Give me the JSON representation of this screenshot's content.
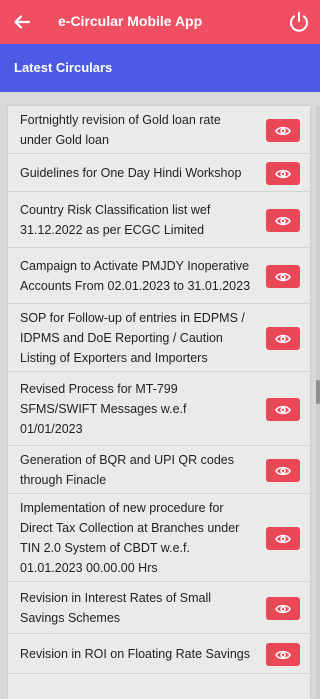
{
  "app": {
    "title": "e-Circular Mobile App"
  },
  "section": {
    "title": "Latest Circulars"
  },
  "colors": {
    "topbar": "#ef4f60",
    "section_bar": "#4c5ae6",
    "view_button": "#ea4757"
  },
  "icons": {
    "back": "arrow-left-icon",
    "power": "power-icon",
    "view": "eye-icon"
  },
  "circulars": [
    {
      "title": "Fortnightly revision of Gold loan rate\nunder Gold loan"
    },
    {
      "title": "Guidelines for One Day Hindi Workshop"
    },
    {
      "title": "Country Risk Classification list wef\n31.12.2022 as per ECGC Limited"
    },
    {
      "title": "Campaign to Activate PMJDY Inoperative\nAccounts From 02.01.2023 to 31.01.2023"
    },
    {
      "title": "SOP for Follow-up of entries in EDPMS /\nIDPMS and DoE Reporting / Caution\nListing of Exporters and Importers"
    },
    {
      "title": "Revised Process for MT-799\nSFMS/SWIFT Messages w.e.f\n01/01/2023"
    },
    {
      "title": "Generation of BQR and UPI QR codes\nthrough Finacle"
    },
    {
      "title": "Implementation of new procedure for\nDirect Tax Collection at Branches under\nTIN 2.0 System of CBDT w.e.f.\n01.01.2023 00.00.00 Hrs"
    },
    {
      "title": "Revision in Interest Rates of Small\nSavings Schemes"
    },
    {
      "title": "Revision in ROI on Floating Rate Savings"
    }
  ]
}
